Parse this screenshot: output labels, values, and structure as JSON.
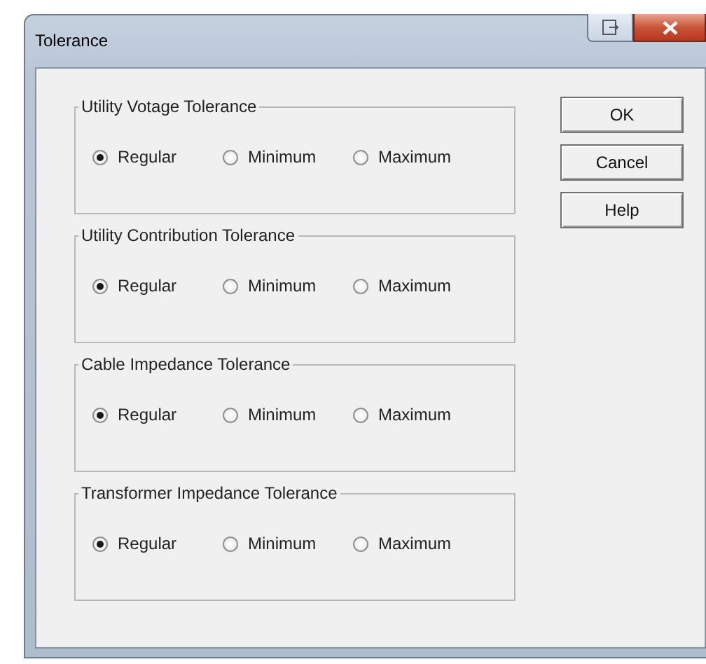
{
  "window": {
    "title": "Tolerance"
  },
  "groups": [
    {
      "title": "Utility Votage Tolerance",
      "options": [
        {
          "label": "Regular",
          "selected": true
        },
        {
          "label": "Minimum",
          "selected": false
        },
        {
          "label": "Maximum",
          "selected": false
        }
      ]
    },
    {
      "title": "Utility Contribution Tolerance",
      "options": [
        {
          "label": "Regular",
          "selected": true
        },
        {
          "label": "Minimum",
          "selected": false
        },
        {
          "label": "Maximum",
          "selected": false
        }
      ]
    },
    {
      "title": "Cable Impedance Tolerance",
      "options": [
        {
          "label": "Regular",
          "selected": true
        },
        {
          "label": "Minimum",
          "selected": false
        },
        {
          "label": "Maximum",
          "selected": false
        }
      ]
    },
    {
      "title": "Transformer Impedance Tolerance",
      "options": [
        {
          "label": "Regular",
          "selected": true
        },
        {
          "label": "Minimum",
          "selected": false
        },
        {
          "label": "Maximum",
          "selected": false
        }
      ]
    }
  ],
  "buttons": [
    "OK",
    "Cancel",
    "Help"
  ]
}
